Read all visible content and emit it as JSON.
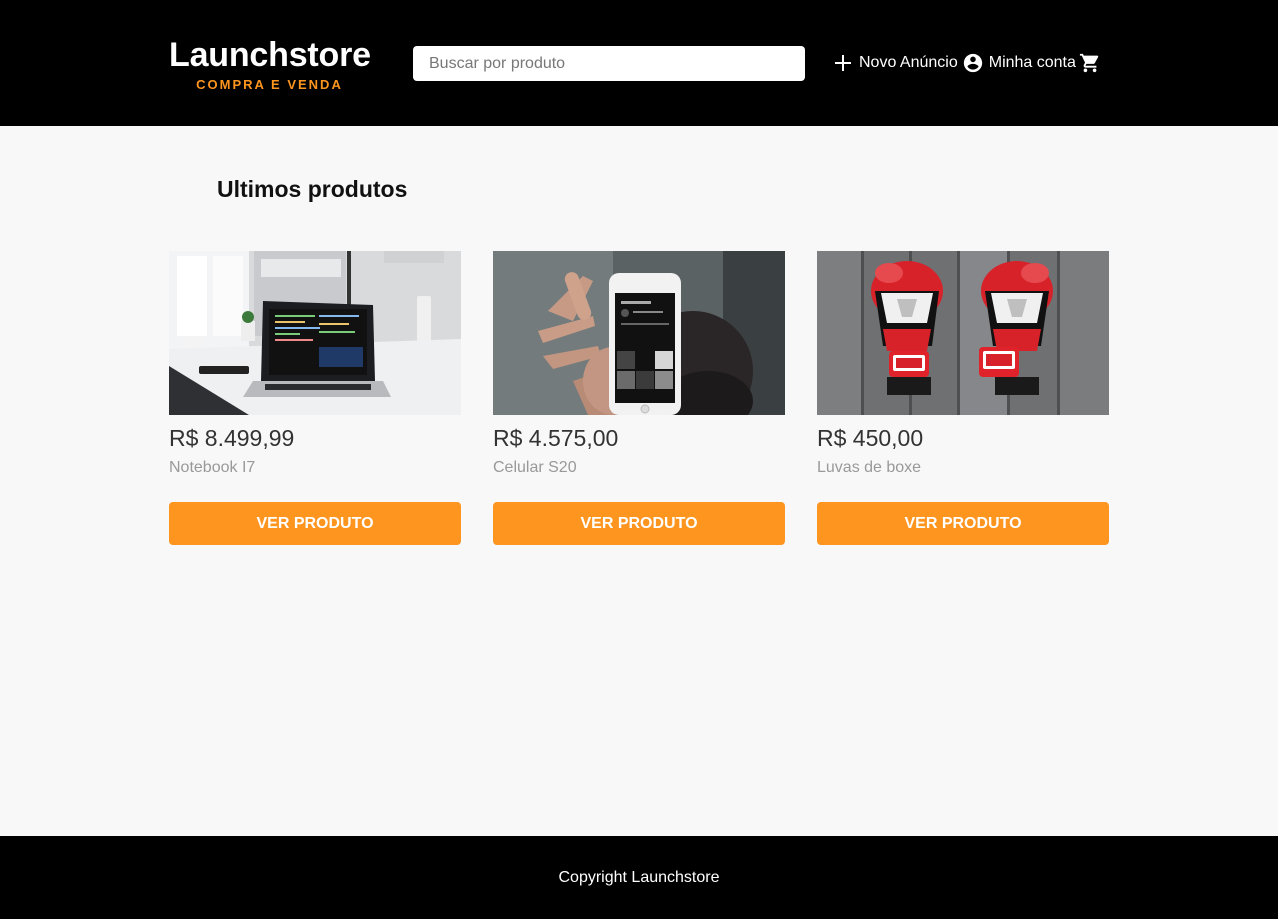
{
  "header": {
    "logo_title": "Launchstore",
    "logo_subtitle": "COMPRA E VENDA",
    "search_placeholder": "Buscar por produto",
    "nav": {
      "new_ad": "Novo Anúncio",
      "account": "Minha conta"
    }
  },
  "main": {
    "section_title": "Ultimos produtos",
    "products": [
      {
        "price": "R$ 8.499,99",
        "name": "Notebook I7",
        "button": "Ver produto",
        "image": "laptop-photo"
      },
      {
        "price": "R$ 4.575,00",
        "name": "Celular S20",
        "button": "Ver produto",
        "image": "phone-photo"
      },
      {
        "price": "R$ 450,00",
        "name": "Luvas de boxe",
        "button": "Ver produto",
        "image": "boxing-gloves-photo"
      }
    ]
  },
  "footer": {
    "copyright": "Copyright Launchstore"
  },
  "colors": {
    "accent": "#fd951f",
    "header_bg": "#000000",
    "page_bg": "#f8f8f8"
  },
  "icons": {
    "new_ad": "plus-icon",
    "account": "account-circle-icon",
    "cart": "shopping-cart-icon"
  }
}
